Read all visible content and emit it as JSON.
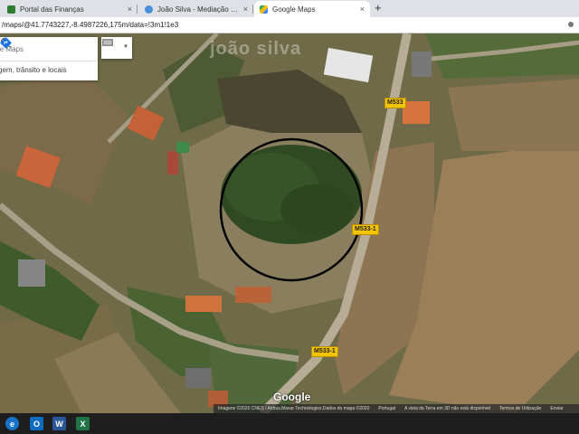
{
  "browser": {
    "tabs": [
      {
        "label": "Portal das Finanças",
        "icon": "finance-portal-icon",
        "active": false
      },
      {
        "label": "João Silva - Mediação Imobiliári...",
        "icon": "globe-icon",
        "active": false
      },
      {
        "label": "Google Maps",
        "icon": "google-maps-icon",
        "active": true
      }
    ],
    "new_tab": "+",
    "close": "×",
    "address": "/maps/@41.7743227,-8.4987226,175m/data=!3m1!1e3"
  },
  "map": {
    "search_placeholder": "le Maps",
    "suggestion": "gem, trânsito e locais",
    "road_labels": [
      "M533",
      "M533-1",
      "M533-1"
    ],
    "watermark": "joão silva",
    "google_logo": "Google",
    "attribution": [
      "Imagens ©2020 CNES / Airbus,Maxar Technologies,Dados do mapa ©2020",
      "Portugal",
      "A vista da Terra em 3D não está disponível",
      "Termos de Utilização",
      "Enviar"
    ],
    "mode": "satellite"
  },
  "taskbar": {
    "icons": [
      {
        "name": "edge-icon",
        "glyph": "e",
        "color": "#1a73c8"
      },
      {
        "name": "outlook-icon",
        "glyph": "O",
        "color": "#0f6cbd"
      },
      {
        "name": "word-icon",
        "glyph": "W",
        "color": "#2b579a"
      },
      {
        "name": "excel-icon",
        "glyph": "X",
        "color": "#217346"
      }
    ]
  }
}
